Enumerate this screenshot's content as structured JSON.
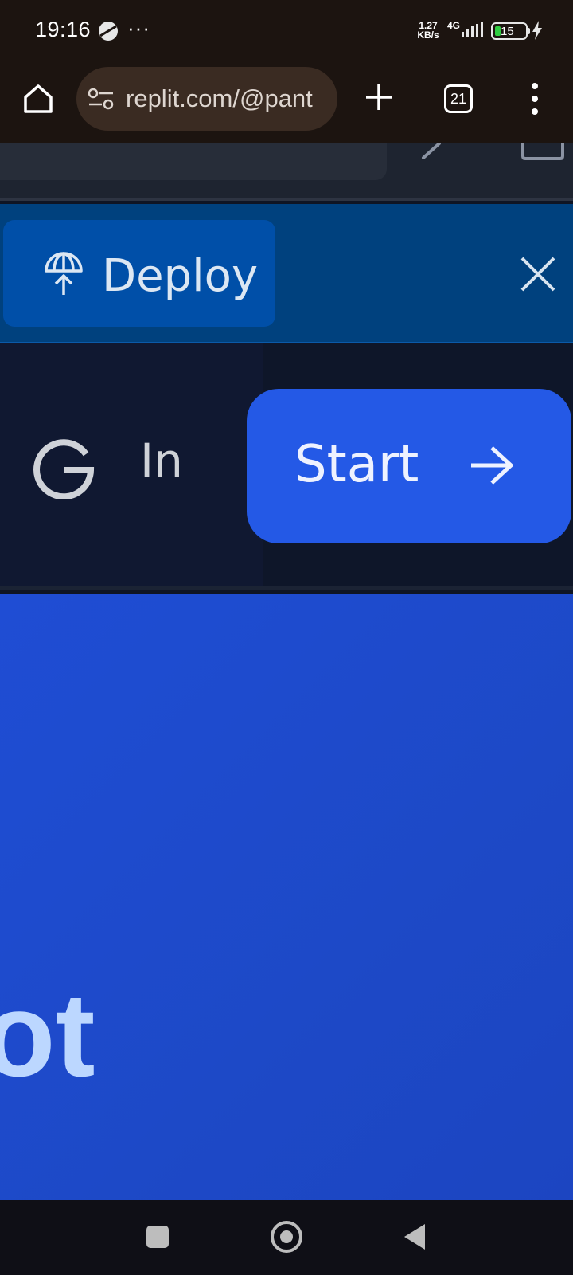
{
  "status_bar": {
    "time": "19:16",
    "more": "···",
    "net_speed_value": "1.27",
    "net_speed_unit": "KB/s",
    "network_type": "4G",
    "battery_level": "15"
  },
  "browser": {
    "url": "replit.com/@pant",
    "tab_count": "21"
  },
  "banner": {
    "deploy_label": "Deploy"
  },
  "auth": {
    "login_label": "In",
    "start_label": "Start"
  },
  "hero": {
    "text": "ot"
  },
  "colors": {
    "status_bg": "#1c1410",
    "deploy_bar": "#00417e",
    "deploy_button": "#004fa8",
    "start_button": "#2459e6",
    "hero_bg": "#1f4dd4",
    "hero_text": "#bcd7ff"
  }
}
